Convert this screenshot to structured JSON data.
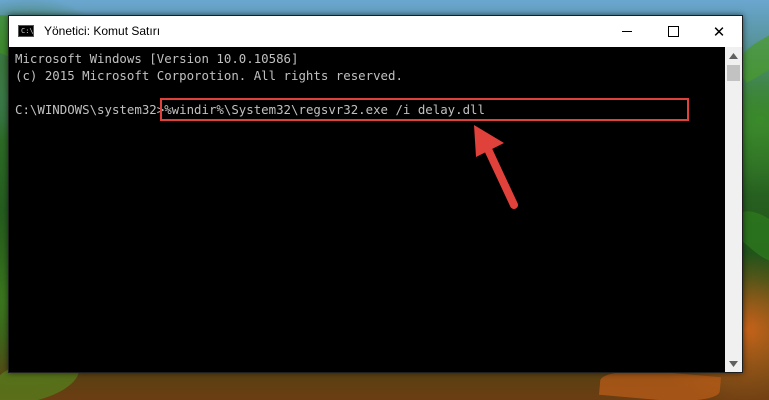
{
  "window": {
    "title": "Yönetici: Komut Satırı",
    "icon": "cmd-icon",
    "icon_text": "C:\\"
  },
  "controls": {
    "minimize": "minimize-icon",
    "maximize": "maximize-icon",
    "close": "close-icon",
    "close_glyph": "✕"
  },
  "console": {
    "lines": [
      "Microsoft Windows [Version 10.0.10586]",
      "(c) 2015 Microsoft Corporotion. All rights reserved.",
      ""
    ],
    "prompt": "C:\\WINDOWS\\system32>",
    "command": "%windir%\\System32\\regsvr32.exe /i delay.dll"
  },
  "annotation": {
    "highlight_color": "#e0413a",
    "arrow_color": "#e0413a"
  }
}
